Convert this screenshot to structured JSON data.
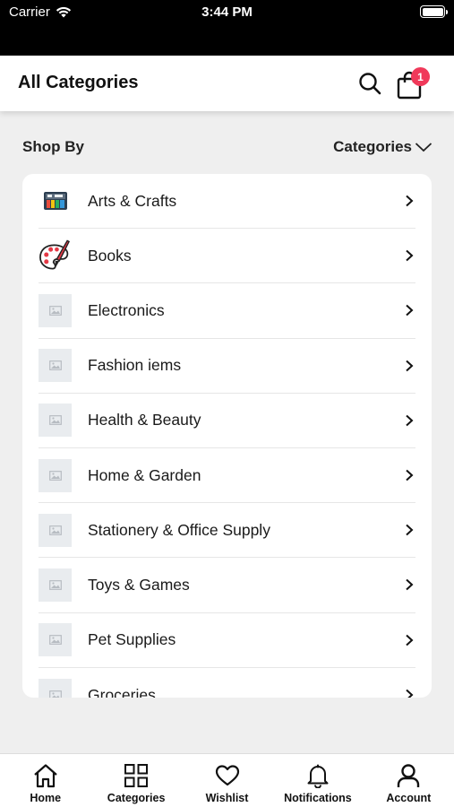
{
  "status_bar": {
    "carrier": "Carrier",
    "time": "3:44 PM"
  },
  "header": {
    "title": "All Categories",
    "cart_count": "1"
  },
  "shop_by": {
    "label": "Shop By",
    "dropdown_value": "Categories"
  },
  "categories": [
    {
      "label": "Arts & Crafts",
      "icon": "arts-crafts-image"
    },
    {
      "label": "Books",
      "icon": "palette-brush-image"
    },
    {
      "label": "Electronics",
      "icon": "image-placeholder-icon"
    },
    {
      "label": "Fashion iems",
      "icon": "image-placeholder-icon"
    },
    {
      "label": "Health & Beauty",
      "icon": "image-placeholder-icon"
    },
    {
      "label": "Home & Garden",
      "icon": "image-placeholder-icon"
    },
    {
      "label": "Stationery & Office Supply",
      "icon": "image-placeholder-icon"
    },
    {
      "label": "Toys & Games",
      "icon": "image-placeholder-icon"
    },
    {
      "label": "Pet Supplies",
      "icon": "image-placeholder-icon"
    },
    {
      "label": "Groceries",
      "icon": "image-placeholder-icon"
    }
  ],
  "bottom_nav": [
    {
      "label": "Home",
      "icon": "home-icon"
    },
    {
      "label": "Categories",
      "icon": "grid-icon"
    },
    {
      "label": "Wishlist",
      "icon": "heart-icon"
    },
    {
      "label": "Notifications",
      "icon": "bell-icon"
    },
    {
      "label": "Account",
      "icon": "user-icon"
    }
  ],
  "colors": {
    "badge": "#f0395a",
    "background": "#efefef",
    "status_bar": "#000000"
  }
}
